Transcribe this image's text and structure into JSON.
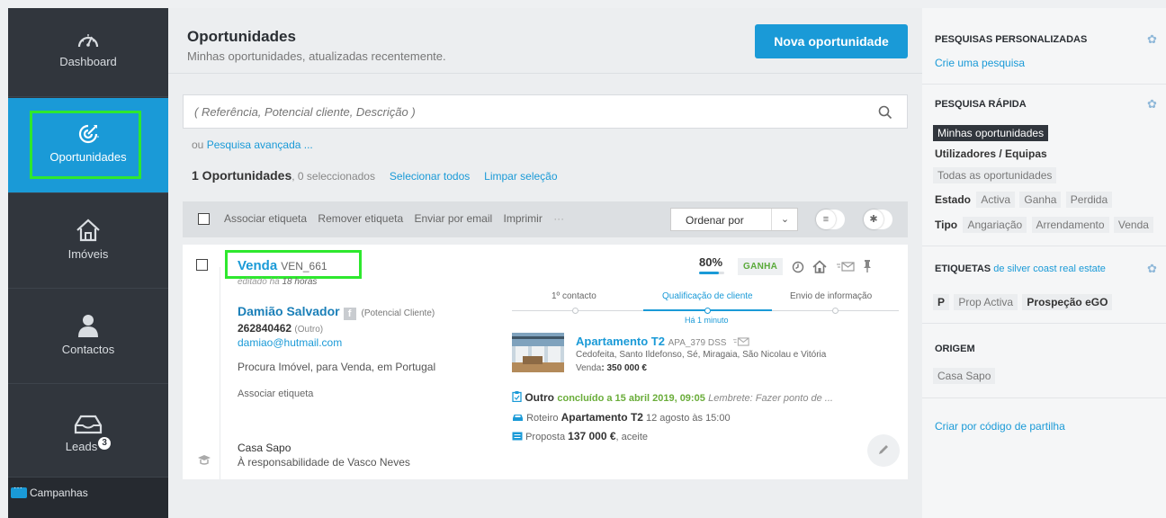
{
  "sidebar": {
    "items": [
      {
        "label": "Dashboard",
        "icon": "speedometer-icon"
      },
      {
        "label": "Oportunidades",
        "icon": "target-icon"
      },
      {
        "label": "Imóveis",
        "icon": "house-icon"
      },
      {
        "label": "Contactos",
        "icon": "person-icon"
      },
      {
        "label": "Leads",
        "icon": "inbox-icon",
        "badge": "3"
      }
    ],
    "campanhas": "Campanhas"
  },
  "header": {
    "title": "Oportunidades",
    "subtitle": "Minhas oportunidades, atualizadas recentemente.",
    "new_button": "Nova oportunidade"
  },
  "search": {
    "placeholder": "( Referência, Potencial cliente, Descrição )",
    "prefix": "ou ",
    "advanced_link": "Pesquisa avançada ..."
  },
  "summary": {
    "count": "1 Oportunidades",
    "selected": ", 0 seleccionados",
    "select_all": "Selecionar todos",
    "clear": "Limpar seleção"
  },
  "toolbar": {
    "actions": [
      "Associar etiqueta",
      "Remover etiqueta",
      "Enviar por email",
      "Imprimir",
      "···"
    ],
    "sort_label": "Ordenar por",
    "sort_caret": "⌄"
  },
  "card": {
    "type": "Venda",
    "ref": "VEN_661",
    "edited_prefix": "editado há ",
    "edited_time": "18 horas",
    "client_name": "Damião Salvador",
    "client_kind": "(Potencial Cliente)",
    "phone": "262840462",
    "phone_kind": "(Outro)",
    "email": "damiao@hutmail.com",
    "search_desc": "Procura Imóvel, para Venda, em Portugal",
    "associate_tag": "Associar etiqueta",
    "source": "Casa Sapo",
    "responsible": "À responsabilidade de Vasco Neves",
    "progress_label": "80%",
    "progress_value": 0.8,
    "status": "GANHA",
    "pipeline": {
      "stages": [
        "1º contacto",
        "Qualificação de cliente",
        "Envio de informação"
      ],
      "current_time": "Há 1 minuto"
    },
    "property": {
      "title": "Apartamento T2",
      "ref": "APA_379 DSS",
      "address": "Cedofeita, Santo Ildefonso, Sé, Miragaia, São Nicolau e Vitória",
      "price_label": "Venda",
      "price": ": 350 000 €"
    },
    "activities": {
      "a1_type": "Outro",
      "a1_status": "concluído a 15 abril 2019, 09:05",
      "a1_note": "Lembrete: Fazer ponto de ...",
      "a2_prefix": "Roteiro",
      "a2_name": "Apartamento T2",
      "a2_when": "12 agosto às 15:00",
      "a3_prefix": "Proposta",
      "a3_value": "137 000 €",
      "a3_status": ", aceite"
    }
  },
  "right_panel": {
    "custom_title": "PESQUISAS PERSONALIZADAS",
    "custom_link": "Crie uma pesquisa",
    "quick_title": "PESQUISA RÁPIDA",
    "quick_selected": "Minhas oportunidades",
    "users_label": "Utilizadores / Equipas",
    "all_opps": "Todas as oportunidades",
    "estado_label": "Estado",
    "estado_options": [
      "Activa",
      "Ganha",
      "Perdida"
    ],
    "tipo_label": "Tipo",
    "tipo_options": [
      "Angariação",
      "Arrendamento",
      "Venda"
    ],
    "tags_title": "ETIQUETAS",
    "tags_suffix": " de silver coast real estate",
    "tags": [
      "P",
      "Prop Activa",
      "Prospeção eGO"
    ],
    "origin_title": "ORIGEM",
    "origin_value": "Casa Sapo",
    "share_link": "Criar por código de partilha"
  },
  "colors": {
    "sidebar": "#31363d",
    "accent": "#1a9ad7",
    "highlight": "#2ee82e",
    "won": "#5aaa3a"
  }
}
